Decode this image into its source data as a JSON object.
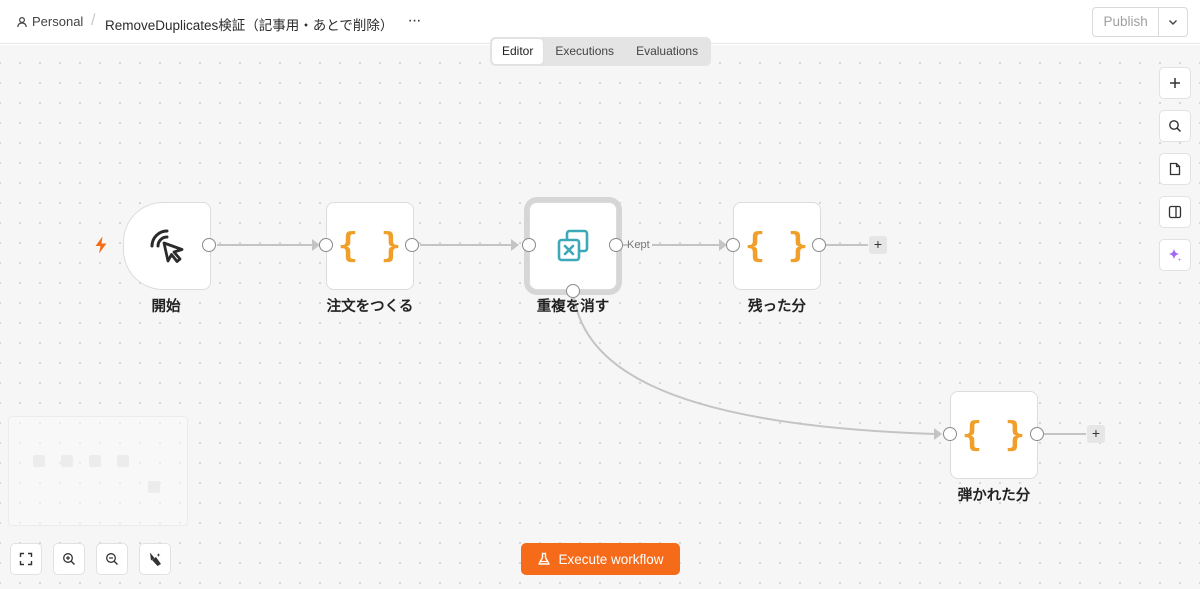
{
  "header": {
    "breadcrumb_personal": "Personal",
    "breadcrumb_separator": "/",
    "workflow_title": "RemoveDuplicates検証（記事用・あとで削除）",
    "more_label": "···",
    "publish_label": "Publish"
  },
  "tabs": [
    {
      "label": "Editor",
      "active": true
    },
    {
      "label": "Executions",
      "active": false
    },
    {
      "label": "Evaluations",
      "active": false
    }
  ],
  "nodes": [
    {
      "label": "開始",
      "icon": "cursor-click-icon"
    },
    {
      "label": "注文をつくる",
      "icon": "code-braces-icon"
    },
    {
      "label": "重複を消す",
      "icon": "remove-duplicates-icon"
    },
    {
      "label": "残った分",
      "icon": "code-braces-icon"
    },
    {
      "label": "弾かれた分",
      "icon": "code-braces-icon"
    }
  ],
  "edge_labels": {
    "kept": "Kept"
  },
  "node_glyphs": {
    "braces": "{ }",
    "add": "+"
  },
  "execute_label": "Execute workflow",
  "colors": {
    "accent": "#f56b1a",
    "braces": "#f0a02a",
    "dedupe_icon": "#3ba9b8",
    "ai_icon": "#a268f0"
  }
}
